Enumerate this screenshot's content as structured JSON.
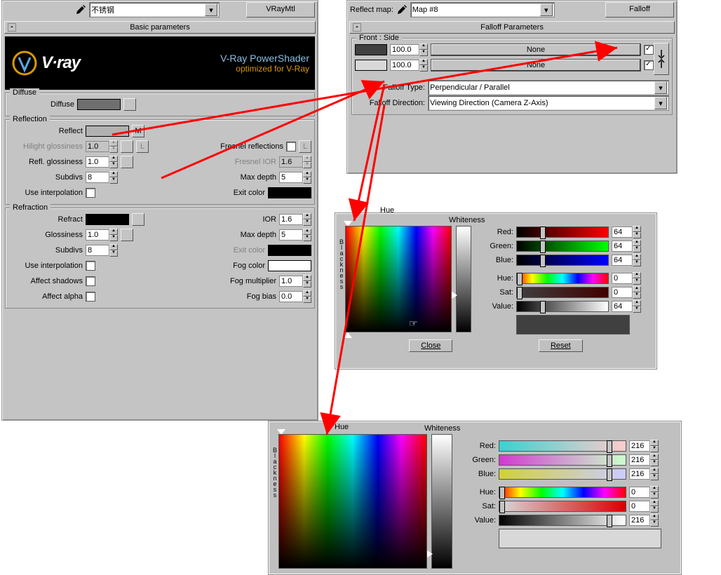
{
  "material": {
    "name": "不锈钢",
    "type": "VRayMtl",
    "basic_param_title": "Basic parameters",
    "banner_logo": "V·ray",
    "banner_ps1": "V-Ray PowerShader",
    "banner_ps2": "optimized for V-Ray",
    "diffuse_title": "Diffuse",
    "diffuse_label": "Diffuse",
    "diffuse_color": "#6f6f6f",
    "reflection_title": "Reflection",
    "reflect_label": "Reflect",
    "reflect_color": "#b1b1b1",
    "reflect_map_btn": "M",
    "hilight_label": "Hilight glossiness",
    "hilight_val": "1.0",
    "L_btn": "L",
    "fresnel_label": "Fresnel reflections",
    "refl_gloss_label": "Refl. glossiness",
    "refl_gloss_val": "1.0",
    "fresnel_ior_label": "Fresnel IOR",
    "fresnel_ior_val": "1.6",
    "subdivs_label": "Subdivs",
    "subdivs_val": "8",
    "maxdepth_label": "Max depth",
    "maxdepth_val": "5",
    "use_interp_label": "Use interpolation",
    "exit_color_label": "Exit color",
    "exit_color": "#000000",
    "refraction_title": "Refraction",
    "refract_label": "Refract",
    "refract_color": "#000000",
    "ior_label": "IOR",
    "ior_val": "1.6",
    "glossiness_label": "Glossiness",
    "glossiness_val": "1.0",
    "r_maxdepth_label": "Max depth",
    "r_maxdepth_val": "5",
    "r_subdivs_label": "Subdivs",
    "r_subdivs_val": "8",
    "r_exit_color_label": "Exit color",
    "r_exit_color": "#000000",
    "r_use_interp_label": "Use interpolation",
    "fog_color_label": "Fog color",
    "fog_color": "#ffffff",
    "affect_shadows_label": "Affect shadows",
    "fog_mult_label": "Fog multiplier",
    "fog_mult_val": "1.0",
    "affect_alpha_label": "Affect alpha",
    "fog_bias_label": "Fog bias",
    "fog_bias_val": "0.0"
  },
  "reflect_map": {
    "label": "Reflect map:",
    "name": "Map #8",
    "type": "Falloff",
    "rollout_title": "Falloff Parameters",
    "frontside_title": "Front : Side",
    "slot1_color": "#404040",
    "slot1_val": "100.0",
    "slot1_map": "None",
    "slot1_on": true,
    "slot2_color": "#d8d8d8",
    "slot2_val": "100.0",
    "slot2_map": "None",
    "slot2_on": true,
    "falloff_type_label": "Falloff Type:",
    "falloff_type": "Perpendicular / Parallel",
    "falloff_dir_label": "Falloff Direction:",
    "falloff_dir": "Viewing Direction (Camera Z-Axis)"
  },
  "picker1": {
    "hue_label": "Hue",
    "white_label": "Whiteness",
    "blackness_label": "Blackness",
    "red_label": "Red:",
    "red_val": "64",
    "green_label": "Green:",
    "green_val": "64",
    "blue_label": "Blue:",
    "blue_val": "64",
    "hue_label2": "Hue:",
    "hue_val": "0",
    "sat_label": "Sat:",
    "sat_val": "0",
    "value_label": "Value:",
    "value_val": "64",
    "preview_color": "#404040",
    "close": "Close",
    "reset": "Reset"
  },
  "picker2": {
    "hue_label": "Hue",
    "white_label": "Whiteness",
    "blackness_label": "Blackness",
    "red_label": "Red:",
    "red_val": "216",
    "green_label": "Green:",
    "green_val": "216",
    "blue_label": "Blue:",
    "blue_val": "216",
    "hue_label2": "Hue:",
    "hue_val": "0",
    "sat_label": "Sat:",
    "sat_val": "0",
    "value_label": "Value:",
    "value_val": "216",
    "preview_color": "#d8d8d8"
  }
}
